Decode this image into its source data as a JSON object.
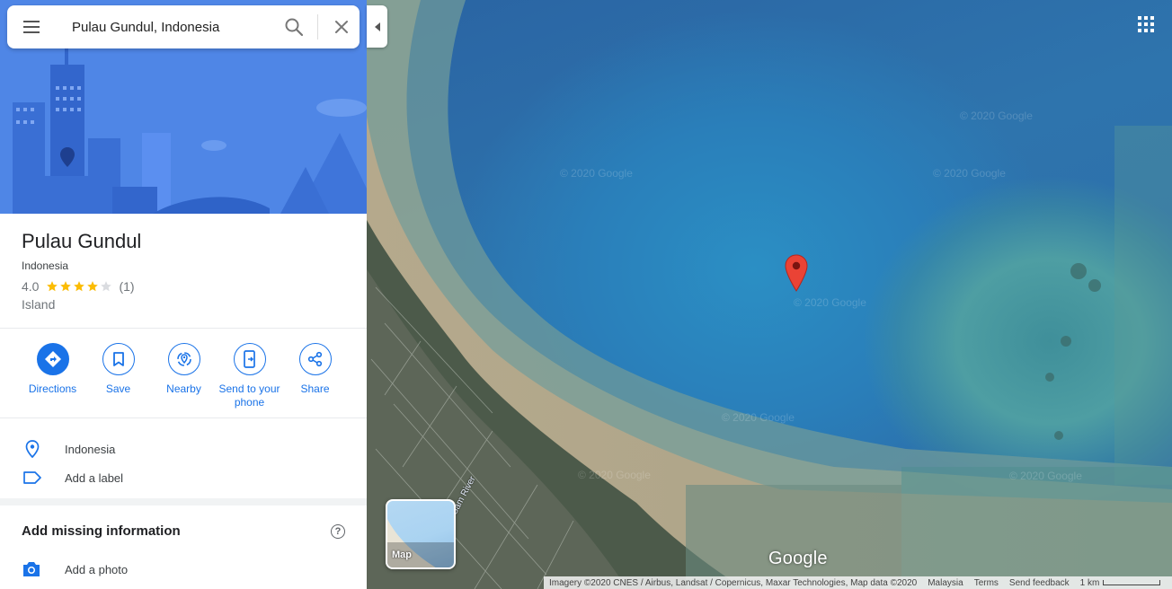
{
  "search": {
    "query": "Pulau Gundul, Indonesia"
  },
  "place": {
    "title": "Pulau Gundul",
    "subtitle": "Indonesia",
    "rating": "4.0",
    "rating_value": 4,
    "rating_max": 5,
    "review_count": "(1)",
    "type": "Island"
  },
  "actions": [
    {
      "label": "Directions",
      "icon": "directions-icon"
    },
    {
      "label": "Save",
      "icon": "bookmark-icon"
    },
    {
      "label": "Nearby",
      "icon": "nearby-icon"
    },
    {
      "label": "Send to your phone",
      "icon": "send-to-phone-icon"
    },
    {
      "label": "Share",
      "icon": "share-icon"
    }
  ],
  "info": {
    "location": "Indonesia",
    "add_label": "Add a label"
  },
  "missing": {
    "title": "Add missing information",
    "add_photo": "Add a photo"
  },
  "map": {
    "layer_label": "Map",
    "logo": "Google",
    "river_label": "Sam River",
    "watermark": "© 2020 Google",
    "footer": {
      "imagery": "Imagery ©2020 CNES / Airbus, Landsat / Copernicus, Maxar Technologies, Map data ©2020",
      "region": "Malaysia",
      "terms": "Terms",
      "feedback": "Send feedback",
      "scale": "1 km"
    }
  },
  "colors": {
    "accent": "#1a73e8",
    "pin": "#ea4335",
    "star": "#fbbc04",
    "hero": "#4f86e6"
  }
}
